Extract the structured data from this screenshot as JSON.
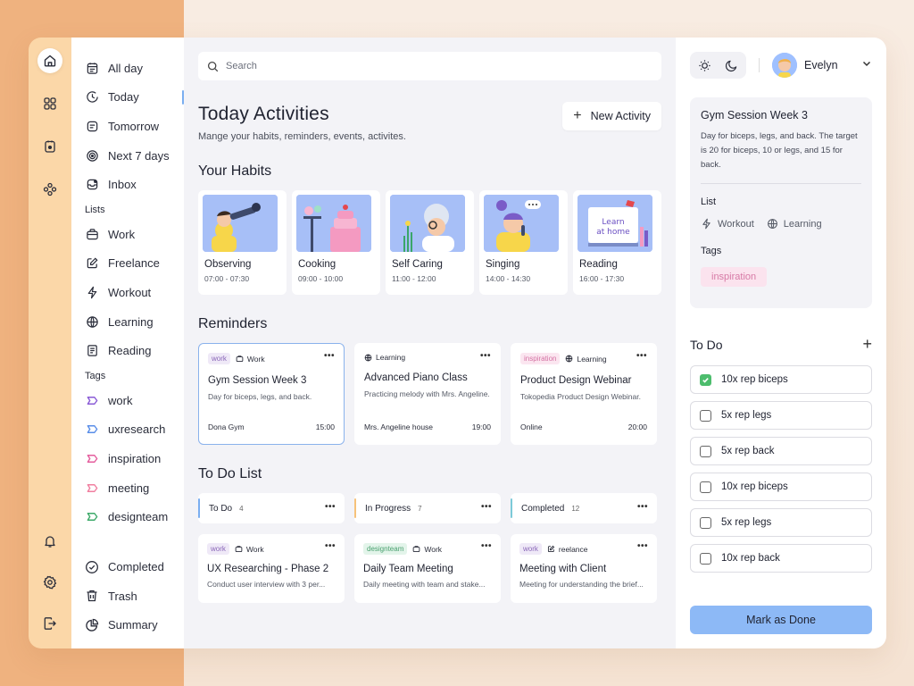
{
  "nav": {
    "items": [
      {
        "label": "All day",
        "icon": "calendar-icon"
      },
      {
        "label": "Today",
        "icon": "clock-icon",
        "active": true
      },
      {
        "label": "Tomorrow",
        "icon": "note-icon"
      },
      {
        "label": "Next 7 days",
        "icon": "target-icon"
      },
      {
        "label": "Inbox",
        "icon": "inbox-icon"
      }
    ],
    "lists_label": "Lists",
    "lists": [
      {
        "label": "Work",
        "icon": "briefcase-icon"
      },
      {
        "label": "Freelance",
        "icon": "edit-icon"
      },
      {
        "label": "Workout",
        "icon": "bolt-icon"
      },
      {
        "label": "Learning",
        "icon": "globe-icon"
      },
      {
        "label": "Reading",
        "icon": "book-icon"
      }
    ],
    "tags_label": "Tags",
    "tags": [
      {
        "label": "work",
        "color": "#8a5bd6"
      },
      {
        "label": "uxresearch",
        "color": "#5a8ee8"
      },
      {
        "label": "inspiration",
        "color": "#e45e9e"
      },
      {
        "label": "meeting",
        "color": "#f07fa0"
      },
      {
        "label": "designteam",
        "color": "#3eaa6a"
      }
    ],
    "bottom": [
      {
        "label": "Completed",
        "icon": "check-circle-icon"
      },
      {
        "label": "Trash",
        "icon": "trash-icon"
      },
      {
        "label": "Summary",
        "icon": "pie-icon"
      }
    ]
  },
  "search": {
    "placeholder": "Search"
  },
  "header": {
    "title": "Today Activities",
    "subtitle": "Mange your habits, reminders, events, activites.",
    "new_button": "New Activity"
  },
  "habits": {
    "title": "Your Habits",
    "items": [
      {
        "name": "Observing",
        "time": "07:00 - 07:30"
      },
      {
        "name": "Cooking",
        "time": "09:00 - 10:00"
      },
      {
        "name": "Self Caring",
        "time": "11:00 - 12:00"
      },
      {
        "name": "Singing",
        "time": "14:00 - 14:30"
      },
      {
        "name": "Reading",
        "time": "16:00 - 17:30",
        "art_text": "Learn at home"
      }
    ]
  },
  "reminders": {
    "title": "Reminders",
    "items": [
      {
        "tag": "work",
        "list": "Work",
        "title": "Gym Session Week 3",
        "desc": "Day for biceps, legs, and back.",
        "place": "Dona Gym",
        "time": "15:00"
      },
      {
        "tag": "",
        "list": "Learning",
        "title": "Advanced Piano Class",
        "desc": "Practicing melody with Mrs. Angeline.",
        "place": "Mrs. Angeline house",
        "time": "19:00"
      },
      {
        "tag": "inspiration",
        "list": "Learning",
        "title": "Product Design Webinar",
        "desc": "Tokopedia Product Design Webinar.",
        "place": "Online",
        "time": "20:00"
      }
    ]
  },
  "todo_list": {
    "title": "To Do List",
    "columns": [
      {
        "label": "To Do",
        "count": "4",
        "color": "#7aaef0"
      },
      {
        "label": "In Progress",
        "count": "7",
        "color": "#f6c27a"
      },
      {
        "label": "Completed",
        "count": "12",
        "color": "#7ccad8"
      }
    ],
    "cards": [
      {
        "tag": "work",
        "list": "Work",
        "title": "UX Researching - Phase 2",
        "desc": "Conduct user interview with 3 per..."
      },
      {
        "tag": "designteam",
        "list": "Work",
        "title": "Daily Team Meeting",
        "desc": "Daily meeting with team and stake..."
      },
      {
        "tag": "work",
        "list": "reelance",
        "title": "Meeting with Client",
        "desc": "Meeting for understanding the brief..."
      }
    ]
  },
  "user": {
    "name": "Evelyn"
  },
  "detail": {
    "title": "Gym Session Week 3",
    "desc": "Day for biceps, legs, and back. The target is 20 for biceps, 10 or legs, and 15 for back.",
    "list_label": "List",
    "lists": [
      "Workout",
      "Learning"
    ],
    "tags_label": "Tags",
    "tag": "inspiration"
  },
  "todo": {
    "title": "To Do",
    "items": [
      {
        "label": "10x rep biceps",
        "checked": true
      },
      {
        "label": "5x rep legs",
        "checked": false
      },
      {
        "label": "5x rep back",
        "checked": false
      },
      {
        "label": "10x rep biceps",
        "checked": false
      },
      {
        "label": "5x rep legs",
        "checked": false
      },
      {
        "label": "10x rep back",
        "checked": false
      }
    ],
    "button": "Mark as Done"
  }
}
